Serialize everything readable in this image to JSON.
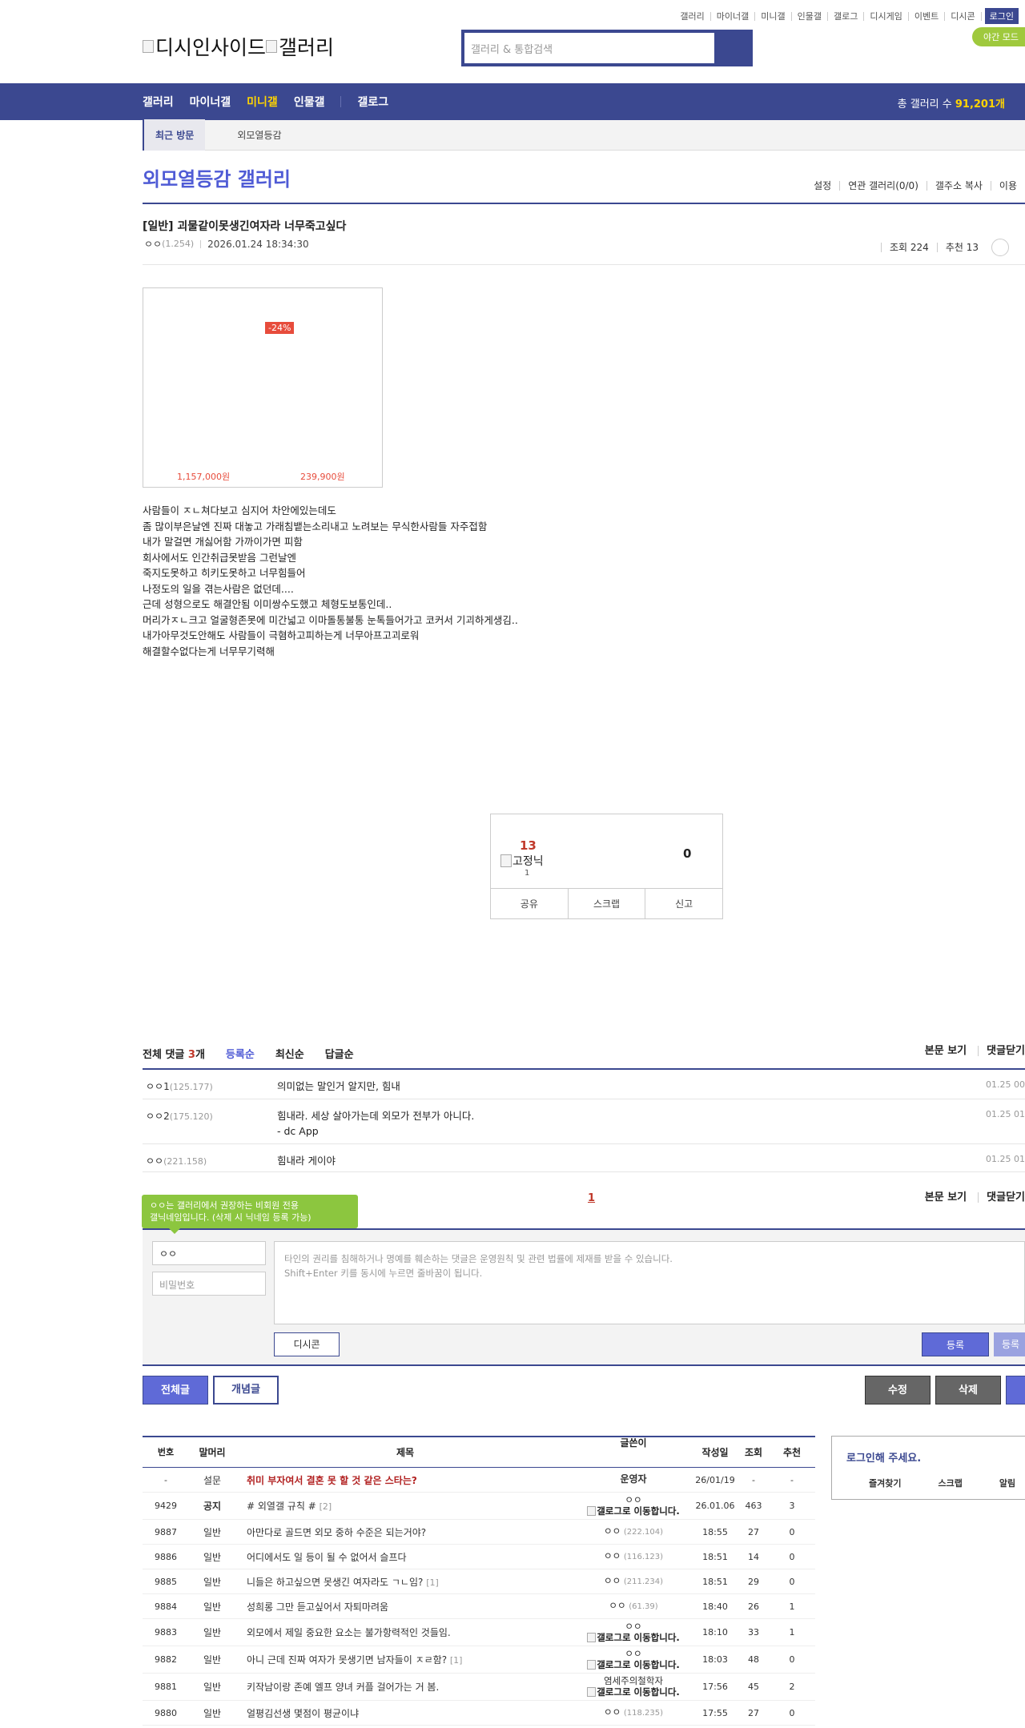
{
  "top_util": [
    "갤러리",
    "마이너갤",
    "미니갤",
    "인물갤",
    "갤로그",
    "디시게임",
    "이벤트",
    "디시콘"
  ],
  "login_label": "로그인",
  "night_label": "야간 모드",
  "logo_text": "디시인사이드",
  "logo_text2": "갤러리",
  "search_placeholder": "갤러리 & 통합검색",
  "gnb": {
    "items": [
      "갤러리",
      "마이너갤",
      "미니갤",
      "인물갤"
    ],
    "gallog": "갤로그",
    "total_label": "총 갤러리 수 ",
    "total_value": "91,201개"
  },
  "visit": {
    "label": "최근 방문",
    "item": "외모열등감"
  },
  "gallery_title": "외모열등감 갤러리",
  "gallery_opts": [
    "설정",
    "연관 갤러리(0/0)",
    "갤주소 복사",
    "이용"
  ],
  "post": {
    "title": "[일반] 괴물같이못생긴여자라 너무죽고싶다",
    "author": "ㅇㅇ",
    "author_ip": "(1.254)",
    "date": "2026.01.24 18:34:30",
    "views": "조회 224",
    "recs": "추천 13"
  },
  "ad": {
    "badge": "-24%",
    "price1": "1,157,000원",
    "price2": "239,900원"
  },
  "body_lines": [
    "사람들이 ㅈㄴ쳐다보고 심지어 차안에있는데도",
    "좀 많이부은날엔 진짜 대놓고 가래침뱉는소리내고 노려보는 무식한사람들 자주접함",
    "내가 말걸면 개싫어함 가까이가면 피함",
    "회사에서도 인간취급못받음 그런날엔",
    "죽지도못하고 히키도못하고 너무힘들어",
    "나정도의 일을 겪는사람은 없던데....",
    "근데 성형으로도 해결안됨 이미쌍수도했고 체형도보통인데..",
    "머리가ㅈㄴ크고 얼굴형존못에 미간넓고 이마돌통불통 눈톡들어가고 코커서 기괴하게생김..",
    "내가아무것도안해도 사람들이 극혐하고피하는게 너무아프고괴로워",
    "해결할수없다는게 너무무기력해"
  ],
  "rec_box": {
    "up": "13",
    "fix_label": "고정닉",
    "fix_count": "1",
    "down": "0",
    "share": "공유",
    "scrap": "스크랩",
    "report": "신고"
  },
  "comments_head": {
    "total_label": "전체 댓글 ",
    "total_count": "3",
    "total_suffix": "개",
    "sort": [
      "등록순",
      "최신순",
      "답글순"
    ],
    "right": [
      "본문 보기",
      "댓글닫기"
    ]
  },
  "comments": [
    {
      "nick": "ㅇㅇ1",
      "ip": "(125.177)",
      "text": "의미없는 말인거 알지만, 힘내",
      "text2": "",
      "date": "01.25 00"
    },
    {
      "nick": "ㅇㅇ2",
      "ip": "(175.120)",
      "text": "힘내라. 세상 살아가는데 외모가 전부가 아니다.",
      "text2": "- dc App",
      "date": "01.25 01"
    },
    {
      "nick": "ㅇㅇ",
      "ip": "(221.158)",
      "text": "힘내라 게이야",
      "text2": "",
      "date": "01.25 01"
    }
  ],
  "pager": "1",
  "tooltip_line1": "ㅇㅇ는 갤러리에서 권장하는 비회원 전용",
  "tooltip_line2": "갤닉네임입니다. (삭제 시 닉네임 등록 가능)",
  "write": {
    "nick_value": "ㅇㅇ",
    "pw_placeholder": "비밀번호",
    "ta_line1": "타인의 권리를 침해하거나 명예를 훼손하는 댓글은 운영원칙 및 관련 법률에 제재를 받을 수 있습니다.",
    "ta_line2": "Shift+Enter 키를 동시에 누르면 줄바꿈이 됩니다.",
    "dccon": "디시콘",
    "submit": "등록",
    "submit2": "등록"
  },
  "buttons": {
    "all": "전체글",
    "concept": "개념글",
    "edit": "수정",
    "delete": "삭제"
  },
  "list_head": [
    "번호",
    "말머리",
    "제목",
    "글쓴이",
    "작성일",
    "조회",
    "추천"
  ],
  "list_rows": [
    {
      "num": "-",
      "head": "설문",
      "title": "취미 부자여서 결혼 못 할 것 같은 스타는?",
      "reply": "",
      "writer": "운영자",
      "wip": "",
      "gallog": "",
      "date": "26/01/19",
      "view": "-",
      "rec": "-",
      "notice": true
    },
    {
      "num": "9429",
      "head": "공지",
      "title": "# 외열갤 규칙 #",
      "reply": "[2]",
      "writer": "ㅇㅇ",
      "wip": "",
      "gallog": "갤로그로 이동합니다.",
      "date": "26.01.06",
      "view": "463",
      "rec": "3",
      "bold": true
    },
    {
      "num": "9887",
      "head": "일반",
      "title": "아만다로 골드면 외모 중하 수준은 되는거야?",
      "reply": "",
      "writer": "ㅇㅇ",
      "wip": "(222.104)",
      "gallog": "",
      "date": "18:55",
      "view": "27",
      "rec": "0"
    },
    {
      "num": "9886",
      "head": "일반",
      "title": "어디에서도 일 등이 될 수 없어서 슬프다",
      "reply": "",
      "writer": "ㅇㅇ",
      "wip": "(116.123)",
      "gallog": "",
      "date": "18:51",
      "view": "14",
      "rec": "0"
    },
    {
      "num": "9885",
      "head": "일반",
      "title": "니들은 하고싶으면 못생긴 여자라도 ㄱㄴ임?",
      "reply": "[1]",
      "writer": "ㅇㅇ",
      "wip": "(211.234)",
      "gallog": "",
      "date": "18:51",
      "view": "29",
      "rec": "0"
    },
    {
      "num": "9884",
      "head": "일반",
      "title": "성희롱 그만 듣고싶어서 자퇴마려움",
      "reply": "",
      "writer": "ㅇㅇ",
      "wip": "(61.39)",
      "gallog": "",
      "date": "18:40",
      "view": "26",
      "rec": "1"
    },
    {
      "num": "9883",
      "head": "일반",
      "title": "외모에서 제일 중요한 요소는 불가항력적인 것들임.",
      "reply": "",
      "writer": "ㅇㅇ",
      "wip": "",
      "gallog": "갤로그로 이동합니다.",
      "date": "18:10",
      "view": "33",
      "rec": "1"
    },
    {
      "num": "9882",
      "head": "일반",
      "title": "아니 근데 진짜 여자가 못생기면 남자들이 ㅈㄹ함?",
      "reply": "[1]",
      "writer": "ㅇㅇ",
      "wip": "",
      "gallog": "갤로그로 이동합니다.",
      "date": "18:03",
      "view": "48",
      "rec": "0"
    },
    {
      "num": "9881",
      "head": "일반",
      "title": "키작남이랑 존예 엘프 양녀 커플 걸어가는 거 봄.",
      "reply": "",
      "writer": "염세주의철학자",
      "wip": "",
      "gallog": "갤로그로 이동합니다.",
      "date": "17:56",
      "view": "45",
      "rec": "2"
    },
    {
      "num": "9880",
      "head": "일반",
      "title": "얼평김선생 몇점이 평균이냐",
      "reply": "",
      "writer": "ㅇㅇ",
      "wip": "(118.235)",
      "gallog": "",
      "date": "17:55",
      "view": "27",
      "rec": "0"
    }
  ],
  "login_box": {
    "title": "로그인해 주세요.",
    "links": [
      "즐겨찾기",
      "스크랩",
      "알림"
    ]
  }
}
